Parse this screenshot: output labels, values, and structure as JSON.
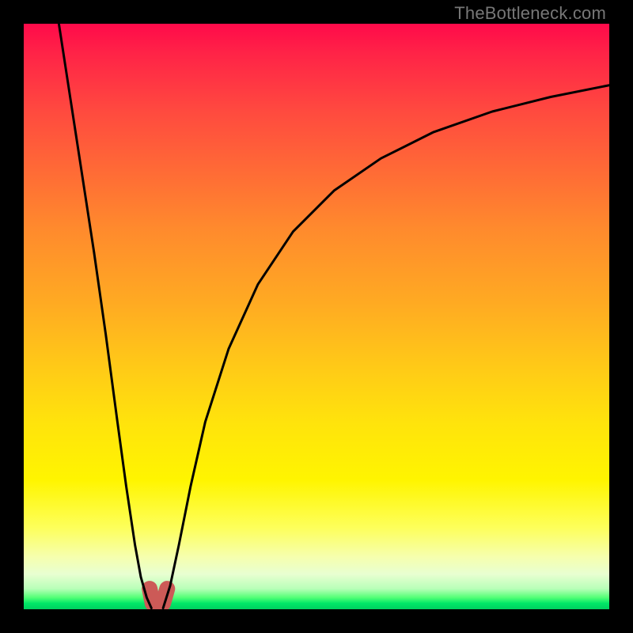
{
  "watermark": {
    "text": "TheBottleneck.com"
  },
  "chart_data": {
    "type": "line",
    "title": "",
    "xlabel": "",
    "ylabel": "",
    "xlim": [
      0,
      1
    ],
    "ylim": [
      0,
      1
    ],
    "grid": false,
    "legend": false,
    "background_gradient": {
      "direction": "top-to-bottom",
      "stops": [
        {
          "t": 0.0,
          "color": "#ff0a4a"
        },
        {
          "t": 0.35,
          "color": "#ff8a2d"
        },
        {
          "t": 0.68,
          "color": "#ffe30c"
        },
        {
          "t": 0.86,
          "color": "#fdff5a"
        },
        {
          "t": 0.95,
          "color": "#e0ffd0"
        },
        {
          "t": 1.0,
          "color": "#00d060"
        }
      ]
    },
    "series": [
      {
        "name": "left-branch",
        "stroke": "#000000",
        "stroke_width": 3,
        "x": [
          0.06,
          0.08,
          0.1,
          0.12,
          0.14,
          0.16,
          0.175,
          0.19,
          0.2,
          0.21,
          0.218
        ],
        "y": [
          1.0,
          0.87,
          0.74,
          0.61,
          0.47,
          0.32,
          0.21,
          0.11,
          0.055,
          0.02,
          0.002
        ]
      },
      {
        "name": "right-branch",
        "stroke": "#000000",
        "stroke_width": 3,
        "x": [
          0.238,
          0.25,
          0.265,
          0.285,
          0.31,
          0.35,
          0.4,
          0.46,
          0.53,
          0.61,
          0.7,
          0.8,
          0.9,
          1.0
        ],
        "y": [
          0.002,
          0.04,
          0.11,
          0.21,
          0.32,
          0.445,
          0.555,
          0.645,
          0.715,
          0.77,
          0.815,
          0.85,
          0.875,
          0.895
        ]
      },
      {
        "name": "valley-marker",
        "stroke": "#cc5a57",
        "stroke_width": 20,
        "linecap": "round",
        "x": [
          0.215,
          0.22,
          0.228,
          0.238,
          0.245
        ],
        "y": [
          0.035,
          0.01,
          0.004,
          0.01,
          0.035
        ]
      }
    ],
    "minimum": {
      "x": 0.228,
      "y": 0.0
    }
  }
}
